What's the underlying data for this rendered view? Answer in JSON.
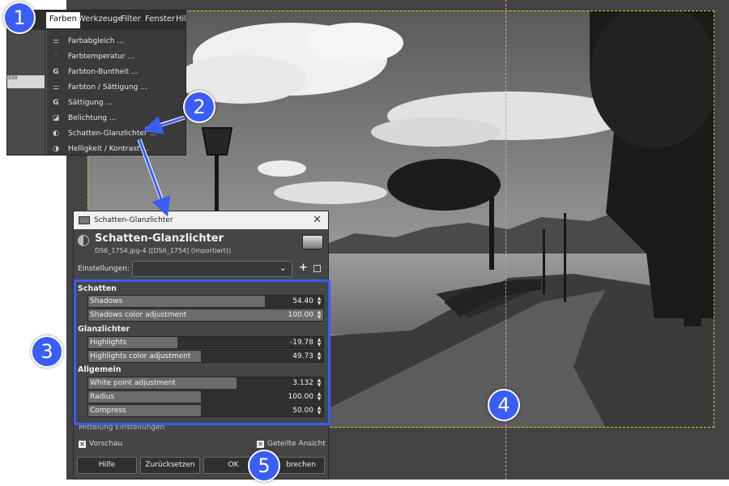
{
  "menu": {
    "menubar": [
      "Farben",
      "Werkzeuge",
      "Filter",
      "Fenster",
      "Hil"
    ],
    "ruler_label": "500",
    "items": [
      {
        "label": "Farbabgleich ...",
        "icon": "color-balance-icon"
      },
      {
        "label": "Farbtemperatur ...",
        "icon": "thermometer-icon"
      },
      {
        "label": "Farbton-Buntheit ...",
        "icon": "gegl-icon"
      },
      {
        "label": "Farbton / Sättigung ...",
        "icon": "hue-saturation-icon"
      },
      {
        "label": "Sättigung ...",
        "icon": "gegl-icon"
      },
      {
        "label": "Belichtung ...",
        "icon": "exposure-icon"
      },
      {
        "label": "Schatten-Glanzlichter ...",
        "icon": "shadows-highlights-icon"
      },
      {
        "label": "Helligkeit / Kontrast ...",
        "icon": "brightness-contrast-icon"
      }
    ]
  },
  "dialog": {
    "window_title": "Schatten-Glanzlichter",
    "close_glyph": "✕",
    "header_title": "Schatten-Glanzlichter",
    "header_subtitle": "DS6_1754.jpg-4 ([DS6_1754] (importiert))",
    "settings_label": "Einstellungen:",
    "sections": [
      {
        "title": "Schatten",
        "sliders": [
          {
            "name": "Shadows",
            "value": "54.40",
            "fraction": 0.75
          },
          {
            "name": "Shadows color adjustment",
            "value": "100.00",
            "fraction": 1.0
          }
        ]
      },
      {
        "title": "Glanzlichter",
        "sliders": [
          {
            "name": "Highlights",
            "value": "-19.78",
            "fraction": 0.38
          },
          {
            "name": "Highlights color adjustment",
            "value": "49.73",
            "fraction": 0.48
          }
        ]
      },
      {
        "title": "Allgemein",
        "sliders": [
          {
            "name": "White point adjustment",
            "value": "3.132",
            "fraction": 0.63
          },
          {
            "name": "Radius",
            "value": "100.00",
            "fraction": 0.48
          },
          {
            "name": "Compress",
            "value": "50.00",
            "fraction": 0.48
          }
        ]
      }
    ],
    "mittelung": "Mittelung Einstellungen",
    "vorschau": "Vorschau",
    "geteilte_ansicht": "Geteilte Ansicht",
    "buttons": {
      "hilfe": "Hilfe",
      "zuruecksetzen": "Zurücksetzen",
      "ok": "OK",
      "abbrechen": "brechen"
    }
  },
  "callouts": [
    "1",
    "2",
    "3",
    "4",
    "5"
  ],
  "colors": {
    "accent": "#3a5df5",
    "selection": "#d8cc3a",
    "split_line": "#e08ae6"
  }
}
